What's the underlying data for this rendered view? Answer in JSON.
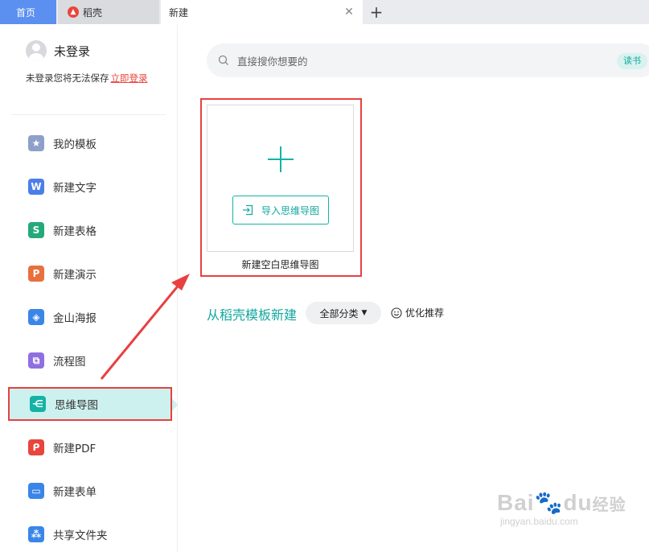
{
  "tabs": {
    "home": "首页",
    "daoke": "稻壳",
    "new": "新建"
  },
  "user": {
    "name": "未登录",
    "tip": "未登录您将无法保存",
    "login_link": "立即登录"
  },
  "sidebar": {
    "items": [
      {
        "label": "我的模板",
        "icon": "star-icon",
        "color": "#8da0c9"
      },
      {
        "label": "新建文字",
        "icon": "writer-icon",
        "color": "#4a7fe8"
      },
      {
        "label": "新建表格",
        "icon": "spreadsheet-icon",
        "color": "#24a97a"
      },
      {
        "label": "新建演示",
        "icon": "presentation-icon",
        "color": "#e8703c"
      },
      {
        "label": "金山海报",
        "icon": "poster-icon",
        "color": "#3a86e8"
      },
      {
        "label": "流程图",
        "icon": "flowchart-icon",
        "color": "#8f6fe0"
      },
      {
        "label": "思维导图",
        "icon": "mindmap-icon",
        "color": "#13b3a5"
      },
      {
        "label": "新建PDF",
        "icon": "pdf-icon",
        "color": "#e8453c"
      },
      {
        "label": "新建表单",
        "icon": "form-icon",
        "color": "#3a86e8"
      },
      {
        "label": "共享文件夹",
        "icon": "shared-folder-icon",
        "color": "#3a86e8"
      }
    ]
  },
  "search": {
    "placeholder": "直接搜你想要的",
    "chip": "读书"
  },
  "blank": {
    "import_label": "导入思维导图",
    "card_label": "新建空白思维导图"
  },
  "templates": {
    "title": "从稻壳模板新建",
    "filter": "全部分类",
    "recommend": "优化推荐"
  },
  "watermark": {
    "brand": "Bai",
    "brand2": "du",
    "suffix": "经验",
    "url": "jingyan.baidu.com"
  },
  "colors": {
    "accent": "#13b3a5",
    "highlight": "#e84040",
    "home_tab": "#5b8ff0"
  }
}
